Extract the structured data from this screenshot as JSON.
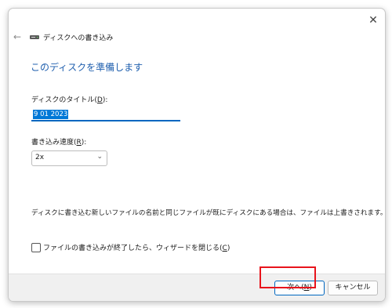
{
  "window": {
    "close_glyph": "✕"
  },
  "titlebar": {
    "back_glyph": "←",
    "title": "ディスクへの書き込み"
  },
  "heading": "このディスクを準備します",
  "disc_title": {
    "label_before": "ディスクのタイトル(",
    "label_key": "D",
    "label_after": "):",
    "value": "9 01 2023"
  },
  "write_speed": {
    "label_before": "書き込み速度(",
    "label_key": "R",
    "label_after": "):",
    "selected": "2x",
    "chevron": "⌄"
  },
  "info_text": "ディスクに書き込む新しいファイルの名前と同じファイルが既にディスクにある場合は、ファイルは上書きされます。",
  "close_wizard": {
    "label_before": "ファイルの書き込みが終了したら、ウィザードを閉じる(",
    "label_key": "C",
    "label_after": ")",
    "checked": false
  },
  "buttons": {
    "next_before": "次へ(",
    "next_key": "N",
    "next_after": ")",
    "cancel": "キャンセル"
  },
  "colors": {
    "accent": "#0067c0",
    "heading": "#1f5fae",
    "highlight": "#e8141c"
  }
}
